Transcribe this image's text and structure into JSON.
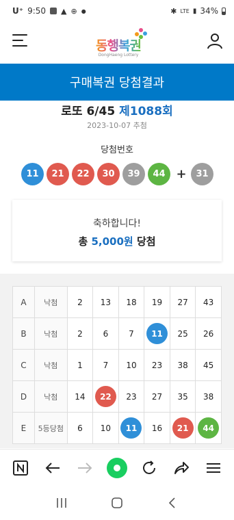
{
  "status_bar": {
    "carrier": "U⁺",
    "time": "9:50",
    "network": "LTE",
    "battery": "34%"
  },
  "header": {
    "logo_text": "동행복권",
    "logo_sub": "DongHaeng Lottery"
  },
  "title_bar": {
    "title": "구매복권 당첨결과"
  },
  "draw": {
    "game": "로또 6/45",
    "round": "제1088회",
    "date": "2023-10-07 추첨"
  },
  "winning": {
    "label": "당첨번호",
    "numbers": [
      {
        "n": "11",
        "color": "#2f8fd8"
      },
      {
        "n": "21",
        "color": "#e05a4f"
      },
      {
        "n": "22",
        "color": "#e05a4f"
      },
      {
        "n": "30",
        "color": "#e05a4f"
      },
      {
        "n": "39",
        "color": "#9e9e9e"
      },
      {
        "n": "44",
        "color": "#5db543"
      }
    ],
    "plus": "+",
    "bonus": {
      "n": "31",
      "color": "#9e9e9e"
    }
  },
  "prize": {
    "congrats": "축하합니다!",
    "prefix": "총 ",
    "amount": "5,000원",
    "suffix": " 당첨"
  },
  "tickets": [
    {
      "key": "A",
      "result": "낙첨",
      "nums": [
        "2",
        "13",
        "18",
        "19",
        "27",
        "43"
      ],
      "hits": [
        null,
        null,
        null,
        null,
        null,
        null
      ]
    },
    {
      "key": "B",
      "result": "낙첨",
      "nums": [
        "2",
        "6",
        "7",
        "11",
        "25",
        "26"
      ],
      "hits": [
        null,
        null,
        null,
        "#2f8fd8",
        null,
        null
      ]
    },
    {
      "key": "C",
      "result": "낙첨",
      "nums": [
        "1",
        "7",
        "10",
        "23",
        "38",
        "45"
      ],
      "hits": [
        null,
        null,
        null,
        null,
        null,
        null
      ]
    },
    {
      "key": "D",
      "result": "낙첨",
      "nums": [
        "14",
        "22",
        "23",
        "27",
        "35",
        "38"
      ],
      "hits": [
        null,
        "#e05a4f",
        null,
        null,
        null,
        null
      ]
    },
    {
      "key": "E",
      "result": "5등당첨",
      "nums": [
        "6",
        "10",
        "11",
        "16",
        "21",
        "44"
      ],
      "hits": [
        null,
        null,
        "#2f8fd8",
        null,
        "#e05a4f",
        "#5db543"
      ]
    }
  ],
  "toolbar": {
    "items": [
      "naver-icon",
      "back-arrow-icon",
      "forward-arrow-icon",
      "green-dot-icon",
      "refresh-icon",
      "share-icon",
      "menu-icon"
    ],
    "accent": "#19ce60"
  },
  "colors": {
    "brand_blue": "#0079c8",
    "title_blue": "#1a6fc0"
  }
}
